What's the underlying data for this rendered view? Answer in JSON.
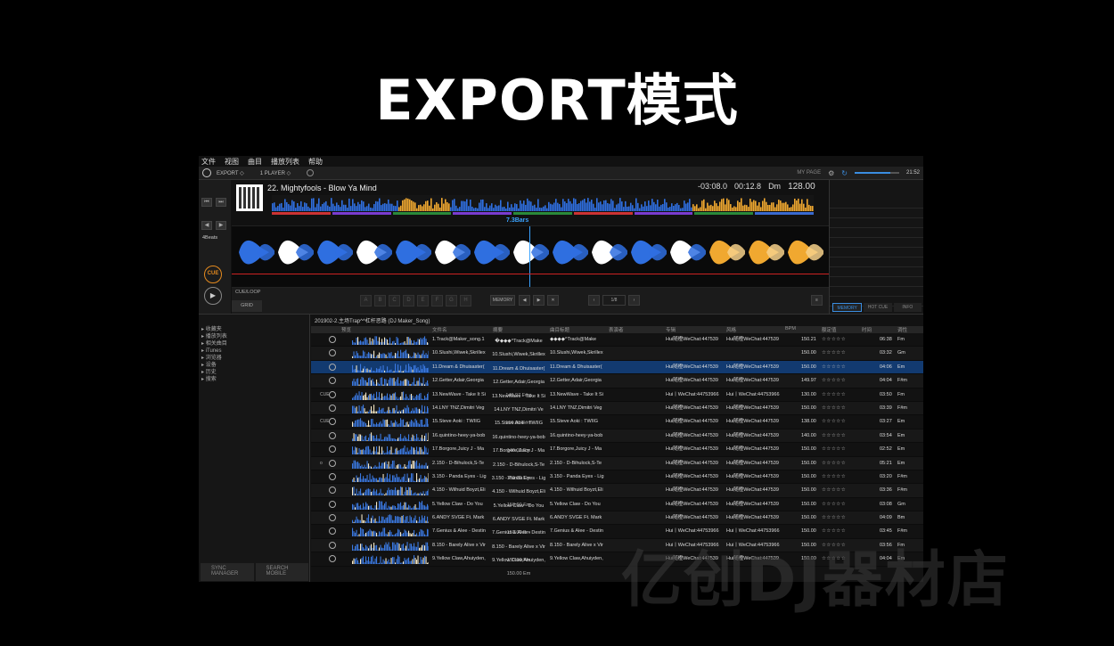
{
  "slide": {
    "title": "EXPORT模式",
    "watermark": "亿创DJ器材店"
  },
  "menu": [
    "文件",
    "视图",
    "曲目",
    "播放列表",
    "帮助"
  ],
  "toolbar": {
    "mode": "EXPORT ◇",
    "player": "1 PLAYER ◇",
    "my_page": "MY PAGE",
    "clock": "21:52"
  },
  "deck": {
    "track_title": "22. Mightyfools - Blow Ya Mind",
    "remain": "-03:08.0",
    "elapsed": "00:12.8",
    "key": "Dm",
    "bpm": "128.00",
    "beats": "4Beats",
    "bars_marker": "7.3Bars",
    "cue_label": "CUE",
    "cue_loop": "CUE/LOOP",
    "grid": "GRID",
    "pads": [
      "A",
      "B",
      "C",
      "D",
      "E",
      "F",
      "G",
      "H"
    ],
    "memory": "MEMORY",
    "beat_jump": "1/8"
  },
  "side_tabs": [
    "MEMORY",
    "HOT CUE",
    "INFO"
  ],
  "tree": {
    "items": [
      "收藏夹",
      "播放列表",
      "相关曲目",
      "iTunes",
      "浏览器",
      "设备",
      "历史",
      "搜索"
    ],
    "sync_manager": "SYNC MANAGER",
    "search_mobile": "SEARCH MOBILE"
  },
  "browser": {
    "playlist": "201902-2.主场Trap^^杠杆恶路 (DJ Maker_Song)",
    "columns": [
      "预览",
      "文件名",
      "摘要",
      "曲目标题",
      "表演者",
      "专辑",
      "风格",
      "BPM",
      "额定值",
      "时间",
      "调性"
    ],
    "rows": [
      {
        "icon": "",
        "file": "1.Track@Maker_song.1",
        "summary": [
          "�◆◆◆^Track@Make",
          "150.21 Gm"
        ],
        "title": "◆◆◆◆^Track@Make",
        "album": "Hui随橙WeChat:447539",
        "genre": "Hui随橙WeChat:447539",
        "bpm": "150.21",
        "rating": "☆☆☆☆☆",
        "time": "06:38",
        "key": "Fm"
      },
      {
        "icon": "",
        "file": "10.Slushi,Wiwek,Skrillex",
        "summary": [
          "10.Slushi,Wiwek,Skrillex",
          "150.00 Gm"
        ],
        "title": "10.Slushi,Wiwek,Skrillex",
        "album": "",
        "genre": "",
        "bpm": "150.00",
        "rating": "☆☆☆☆☆",
        "time": "03:32",
        "key": "Gm"
      },
      {
        "icon": "",
        "file": "11.Dream & Dhuisaster(",
        "summary": [
          "11.Dream & Dhuisaster(",
          "150.00 Em"
        ],
        "title": "11.Dream & Dhuisaster(",
        "album": "Hui随橙WeChat:447539",
        "genre": "Hui随橙WeChat:447539",
        "bpm": "150.00",
        "rating": "☆☆☆☆☆",
        "time": "04:06",
        "key": "Em"
      },
      {
        "icon": "",
        "file": "12.Getter,Adair,Georgia",
        "summary": [
          "12.Getter,Adair,Georgia",
          "149.97 F#m"
        ],
        "title": "12.Getter,Adair,Georgia",
        "album": "Hui随橙WeChat:447539",
        "genre": "Hui随橙WeChat:447539",
        "bpm": "149.97",
        "rating": "☆☆☆☆☆",
        "time": "04:04",
        "key": "F#m"
      },
      {
        "icon": "CUE",
        "file": "13.NewWave - Take It Si",
        "summary": [
          "13.NewWave - Take It Si",
          "130.00 Fm"
        ],
        "title": "13.NewWave - Take It Si",
        "album": "Hui丨WeChat:44753966",
        "genre": "Hui丨WeChat:44753966",
        "bpm": "130.00",
        "rating": "☆☆☆☆☆",
        "time": "03:50",
        "key": "Fm"
      },
      {
        "icon": "",
        "file": "14.LNY TNZ,Dimitri Veg",
        "summary": [
          "14.LNY TNZ,Dimitri Ve",
          "150.00 F#m"
        ],
        "title": "14.LNY TNZ,Dimitri Veg",
        "album": "Hui随橙WeChat:447539",
        "genre": "Hui随橙WeChat:447539",
        "bpm": "150.00",
        "rating": "☆☆☆☆☆",
        "time": "03:39",
        "key": "F#m"
      },
      {
        "icon": "CUE",
        "file": "15.Steve Aoki : TWIIG",
        "summary": [
          "15.Steve Aoki : TWIIG",
          "138.00 Em"
        ],
        "title": "15.Steve Aoki : TWIIG",
        "album": "Hui随橙WeChat:447539",
        "genre": "Hui随橙WeChat:447539",
        "bpm": "138.00",
        "rating": "☆☆☆☆☆",
        "time": "03:27",
        "key": "Em"
      },
      {
        "icon": "",
        "file": "16.quintino-heey-ya-bob",
        "summary": [
          "16.quintino-heey-ya-bob",
          "140.00 Em"
        ],
        "title": "16.quintino-heey-ya-bob",
        "album": "Hui随橙WeChat:447539",
        "genre": "Hui随橙WeChat:447539",
        "bpm": "140.00",
        "rating": "☆☆☆☆☆",
        "time": "03:54",
        "key": "Em"
      },
      {
        "icon": "",
        "file": "17.Borgore,Juicy J - Ma",
        "summary": [
          "17.Borgore,Juicy J - Ma",
          "150.00 F#m"
        ],
        "title": "17.Borgore,Juicy J - Ma",
        "album": "Hui随橙WeChat:447539",
        "genre": "Hui随橙WeChat:447539",
        "bpm": "150.00",
        "rating": "☆☆☆☆☆",
        "time": "02:52",
        "key": "Em"
      },
      {
        "icon": "o",
        "file": "2.150 - D-Bihulock,S-Te",
        "summary": [
          "2.150 - D-Bihulock,S-Te",
          "150.00 Em"
        ],
        "title": "2.150 - D-Bihulock,S-Te",
        "album": "Hui随橙WeChat:447539",
        "genre": "Hui随橙WeChat:447539",
        "bpm": "150.00",
        "rating": "☆☆☆☆☆",
        "time": "05:21",
        "key": "Em"
      },
      {
        "icon": "",
        "file": "3.150 - Panda Eyes - Lig",
        "summary": [
          "3.150 - Panda Eyes - Lig",
          "150.00 Fm"
        ],
        "title": "3.150 - Panda Eyes - Lig",
        "album": "Hui随橙WeChat:447539",
        "genre": "Hui随橙WeChat:447539",
        "bpm": "150.00",
        "rating": "☆☆☆☆☆",
        "time": "03:20",
        "key": "F#m"
      },
      {
        "icon": "",
        "file": "4.150 - Wilhuid Boyzt,Eli",
        "summary": [
          "4.150 - Wilhuid Boyzt,Eli",
          "150.00 Fm"
        ],
        "title": "4.150 - Wilhuid Boyzt,Eli",
        "album": "Hui随橙WeChat:447539",
        "genre": "Hui随橙WeChat:447539",
        "bpm": "150.00",
        "rating": "☆☆☆☆☆",
        "time": "03:36",
        "key": "F#m"
      },
      {
        "icon": "",
        "file": "5.Yellow Claw - Do You",
        "summary": [
          "5.Yellow Claw - Do You",
          "150.00 Gm"
        ],
        "title": "5.Yellow Claw - Do You",
        "album": "Hui随橙WeChat:447539",
        "genre": "Hui随橙WeChat:447539",
        "bpm": "150.00",
        "rating": "☆☆☆☆☆",
        "time": "03:08",
        "key": "Gm"
      },
      {
        "icon": "",
        "file": "6.ANDY SVGE Ft. Mark",
        "summary": [
          "6.ANDY SVGE Ft. Mark",
          "150.00 Bm"
        ],
        "title": "6.ANDY SVGE Ft. Mark",
        "album": "Hui随橙WeChat:447539",
        "genre": "Hui随橙WeChat:447539",
        "bpm": "150.00",
        "rating": "☆☆☆☆☆",
        "time": "04:09",
        "key": "Bm"
      },
      {
        "icon": "",
        "file": "7.Genius & Alee - Destin",
        "summary": [
          "7.Genius & Alee - Destin",
          "150.00 F#m"
        ],
        "title": "7.Genius & Alee - Destin",
        "album": "Hui丨WeChat:44753966",
        "genre": "Hui丨WeChat:44753966",
        "bpm": "150.00",
        "rating": "☆☆☆☆☆",
        "time": "03:45",
        "key": "F#m"
      },
      {
        "icon": "",
        "file": "8.150 - Barely Alive x Vir",
        "summary": [
          "8.150 - Barely Alive x Vir",
          "150.00 Fm"
        ],
        "title": "8.150 - Barely Alive x Vir",
        "album": "Hui丨WeChat:44753966",
        "genre": "Hui丨WeChat:44753966",
        "bpm": "150.00",
        "rating": "☆☆☆☆☆",
        "time": "03:56",
        "key": "Fm"
      },
      {
        "icon": "",
        "file": "9.Yellow Claw,Ahuiyden,",
        "summary": [
          "9.Yellow Claw,Ahuiyden,",
          "150.00 Em"
        ],
        "title": "9.Yellow Claw,Ahuiyden,",
        "album": "Hui随橙WeChat:447539",
        "genre": "Hui随橙WeChat:447539",
        "bpm": "150.00",
        "rating": "☆☆☆☆☆",
        "time": "04:04",
        "key": "Em"
      }
    ]
  },
  "colors": {
    "accent": "#3a8de0",
    "cue": "#e48a1e",
    "selected_row": "#123a70",
    "wave_blue": "#2f6fe0",
    "wave_orange": "#f0a830"
  }
}
